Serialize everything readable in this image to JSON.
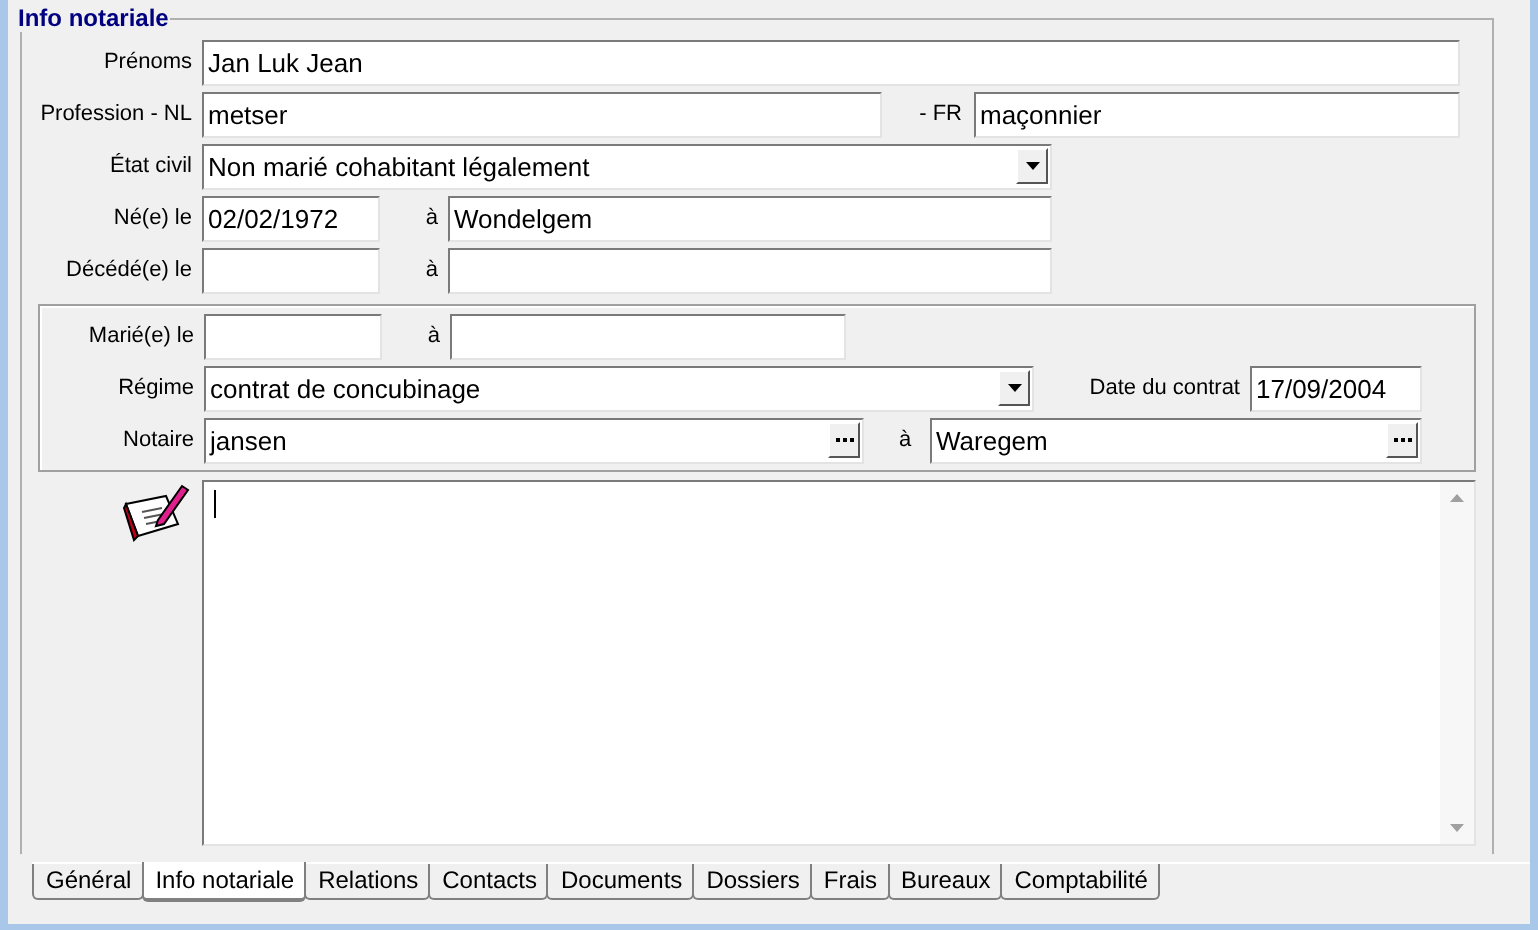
{
  "group": {
    "title": "Info notariale"
  },
  "prenoms": {
    "label": "Prénoms",
    "value": "Jan Luk Jean"
  },
  "profession": {
    "label": "Profession - NL",
    "value": "metser",
    "fr_label": "- FR",
    "fr_value": "maçonnier"
  },
  "etat_civil": {
    "label": "État civil",
    "value": "Non marié cohabitant légalement"
  },
  "naissance": {
    "label": "Né(e) le",
    "date": "02/02/1972",
    "place_label": "à",
    "place": "Wondelgem"
  },
  "deces": {
    "label": "Décédé(e) le",
    "place_label": "à"
  },
  "mariage": {
    "label": "Marié(e) le",
    "place_label": "à"
  },
  "regime": {
    "label": "Régime",
    "value": "contrat de concubinage",
    "contract_label": "Date du contrat",
    "contract_date": "17/09/2004"
  },
  "notaire": {
    "label": "Notaire",
    "value": "jansen",
    "place_label": "à",
    "place": "Waregem"
  },
  "tabs": [
    {
      "label": "Général",
      "selected": false
    },
    {
      "label": "Info notariale",
      "selected": true
    },
    {
      "label": "Relations",
      "selected": false
    },
    {
      "label": "Contacts",
      "selected": false
    },
    {
      "label": "Documents",
      "selected": false
    },
    {
      "label": "Dossiers",
      "selected": false
    },
    {
      "label": "Frais",
      "selected": false
    },
    {
      "label": "Bureaux",
      "selected": false
    },
    {
      "label": "Comptabilité",
      "selected": false
    }
  ]
}
